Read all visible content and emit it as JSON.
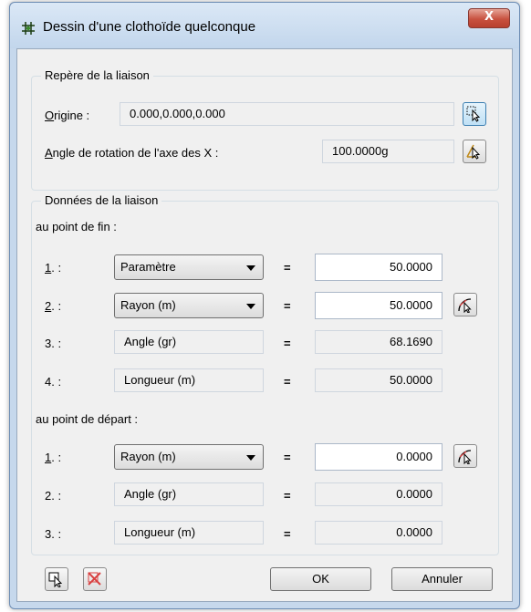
{
  "window": {
    "title": "Dessin d'une clothoïde quelconque",
    "close_label": "X"
  },
  "repere": {
    "title": "Repère de la liaison",
    "origine_label_u": "O",
    "origine_label_rest": "rigine :",
    "origine_value": "0.000,0.000,0.000",
    "angle_label_u": "A",
    "angle_label_rest": "ngle de rotation de l'axe des X :",
    "angle_value": "100.0000g"
  },
  "donnees": {
    "title": "Données de la liaison",
    "fin": {
      "heading": "au point de fin :",
      "row1": {
        "num_u": "1",
        "num_rest": ". :",
        "select": "Paramètre",
        "eq": "=",
        "value": "50.0000"
      },
      "row2": {
        "num_u": "2",
        "num_rest": ". :",
        "select": "Rayon (m)",
        "eq": "=",
        "value": "50.0000"
      },
      "row3": {
        "num": "3. :",
        "label": "Angle (gr)",
        "eq": "=",
        "value": "68.1690"
      },
      "row4": {
        "num": "4. :",
        "label": "Longueur (m)",
        "eq": "=",
        "value": "50.0000"
      }
    },
    "depart": {
      "heading": "au point de départ :",
      "row1": {
        "num_u": "1",
        "num_rest": ". :",
        "select": "Rayon (m)",
        "eq": "=",
        "value": "0.0000"
      },
      "row2": {
        "num": "2. :",
        "label": "Angle (gr)",
        "eq": "=",
        "value": "0.0000"
      },
      "row3": {
        "num": "3. :",
        "label": "Longueur (m)",
        "eq": "=",
        "value": "0.0000"
      }
    }
  },
  "footer": {
    "ok_label": "OK",
    "cancel_label": "Annuler"
  },
  "colors": {
    "accent": "#3c7fb1",
    "close": "#c8513f",
    "pick_red": "#d94040"
  }
}
